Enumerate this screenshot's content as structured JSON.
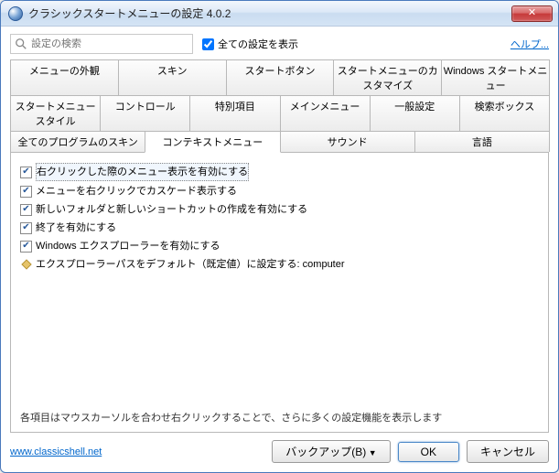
{
  "window": {
    "title": "クラシックスタートメニューの設定 4.0.2"
  },
  "search": {
    "placeholder": "設定の検索",
    "show_all_label": "全ての設定を表示",
    "help_label": "ヘルプ..."
  },
  "tabs": {
    "row1": [
      "メニューの外観",
      "スキン",
      "スタートボタン",
      "スタートメニューのカスタマイズ",
      "Windows スタートメニュー"
    ],
    "row2": [
      "スタートメニュースタイル",
      "コントロール",
      "特別項目",
      "メインメニュー",
      "一般設定",
      "検索ボックス"
    ],
    "row3": [
      "全てのプログラムのスキン",
      "コンテキストメニュー",
      "サウンド",
      "言語"
    ],
    "active": "コンテキストメニュー"
  },
  "tree": {
    "items": [
      {
        "label": "右クリックした際のメニュー表示を有効にする",
        "checked": true,
        "selected": true,
        "children": [
          {
            "label": "メニューを右クリックでカスケード表示する",
            "checked": true
          },
          {
            "label": "新しいフォルダと新しいショートカットの作成を有効にする",
            "checked": true
          }
        ]
      },
      {
        "label": "終了を有効にする",
        "checked": true
      },
      {
        "label": "Windows エクスプローラーを有効にする",
        "checked": true,
        "children": [
          {
            "label": "エクスプローラーパスをデフォルト（既定値）に設定する: computer",
            "type": "value"
          }
        ]
      }
    ]
  },
  "hint": "各項目はマウスカーソルを合わせ右クリックすることで、さらに多くの設定機能を表示します",
  "footer": {
    "url": "www.classicshell.net",
    "backup": "バックアップ(B)",
    "ok": "OK",
    "cancel": "キャンセル"
  }
}
